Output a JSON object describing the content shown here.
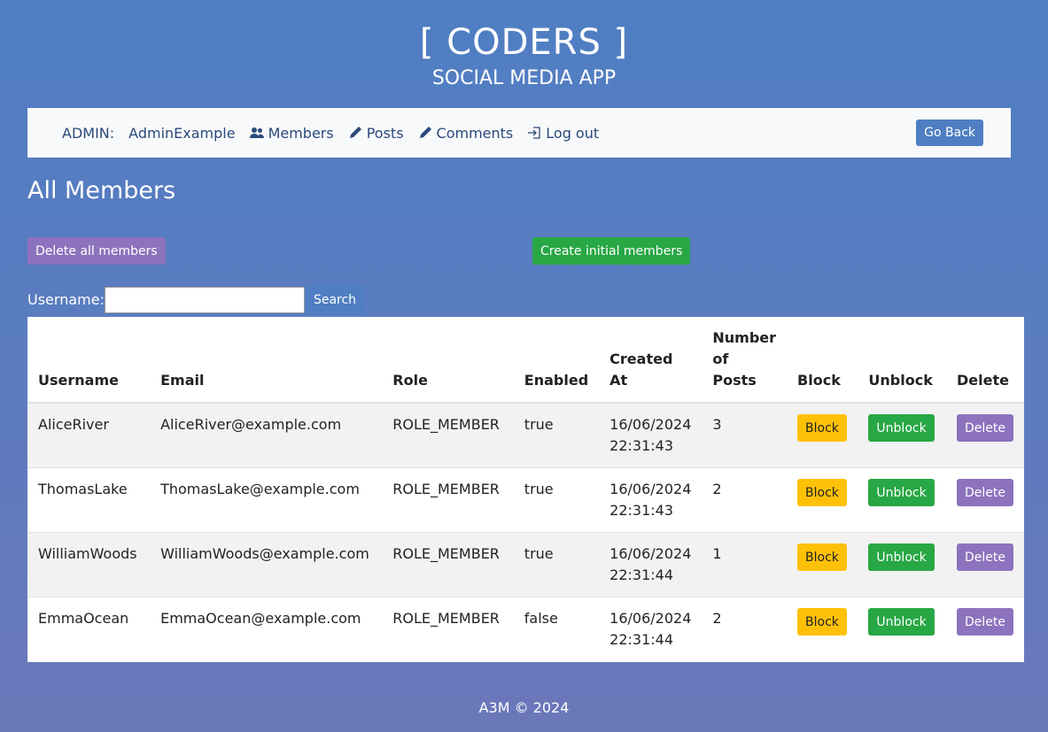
{
  "header": {
    "brand": "[ CODERS ]",
    "subtitle": "SOCIAL MEDIA APP"
  },
  "nav": {
    "admin_label": "ADMIN:",
    "admin_name": "AdminExample",
    "members": "Members",
    "posts": "Posts",
    "comments": "Comments",
    "logout": "Log out",
    "go_back": "Go Back"
  },
  "page": {
    "title": "All Members",
    "delete_all": "Delete all members",
    "create_initial": "Create initial members"
  },
  "search": {
    "label": "Username:",
    "value": "",
    "button": "Search"
  },
  "table": {
    "headers": {
      "username": "Username",
      "email": "Email",
      "role": "Role",
      "enabled": "Enabled",
      "created_at": "Created At",
      "num_posts": "Number of Posts",
      "block": "Block",
      "unblock": "Unblock",
      "delete": "Delete"
    },
    "actions": {
      "block": "Block",
      "unblock": "Unblock",
      "delete": "Delete"
    },
    "rows": [
      {
        "username": "AliceRiver",
        "email": "AliceRiver@example.com",
        "role": "ROLE_MEMBER",
        "enabled": "true",
        "created_at": "16/06/2024 22:31:43",
        "num_posts": "3"
      },
      {
        "username": "ThomasLake",
        "email": "ThomasLake@example.com",
        "role": "ROLE_MEMBER",
        "enabled": "true",
        "created_at": "16/06/2024 22:31:43",
        "num_posts": "2"
      },
      {
        "username": "WilliamWoods",
        "email": "WilliamWoods@example.com",
        "role": "ROLE_MEMBER",
        "enabled": "true",
        "created_at": "16/06/2024 22:31:44",
        "num_posts": "1"
      },
      {
        "username": "EmmaOcean",
        "email": "EmmaOcean@example.com",
        "role": "ROLE_MEMBER",
        "enabled": "false",
        "created_at": "16/06/2024 22:31:44",
        "num_posts": "2"
      }
    ]
  },
  "footer": {
    "text": "A3M © 2024"
  },
  "icons": {
    "members": "users-icon",
    "posts": "pen-icon",
    "comments": "pen-icon",
    "logout": "logout-icon"
  },
  "colors": {
    "background": "#4f7ec2",
    "nav_bg": "#f8f9fa",
    "nav_text": "#2a4a7a",
    "delete": "#8d72bd",
    "create": "#28a745",
    "block": "#ffc107"
  }
}
